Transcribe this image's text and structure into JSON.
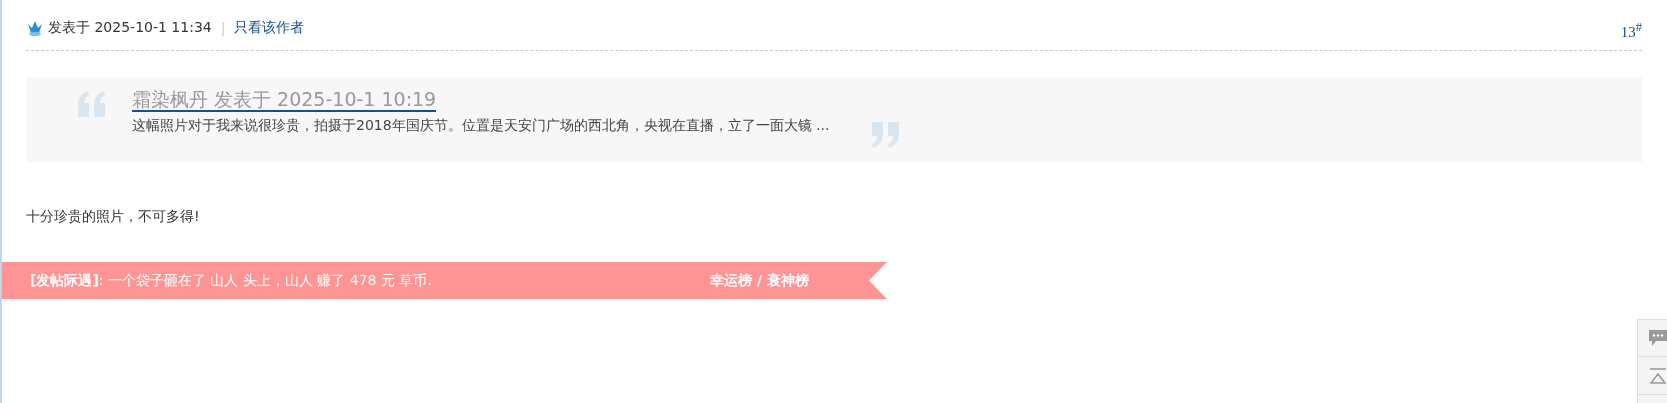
{
  "post": {
    "posted": "发表于 2025-10-1 11:34",
    "separator": "|",
    "only_author_link": "只看该作者",
    "floor": "13$^{#}$"
  },
  "quote": {
    "header": "霜染枫丹 发表于 2025-10-1 10:19",
    "excerpt": "这幅照片对于我来说很珍贵，拍摄于2018年国庆节。位置是天安门广场的西北角，央视在直播，立了一面大镜 ..."
  },
  "message": "十分珍贵的照片，不可多得!",
  "event_banner": {
    "text": "**[发帖际遇]**: 一个袋子砸在了 山人 头上，山人 赚了 478 元 草币.",
    "separator": "/",
    "links": [
      {
        "label": "幸运榜"
      },
      {
        "label": "衰神榜"
      }
    ]
  }
}
